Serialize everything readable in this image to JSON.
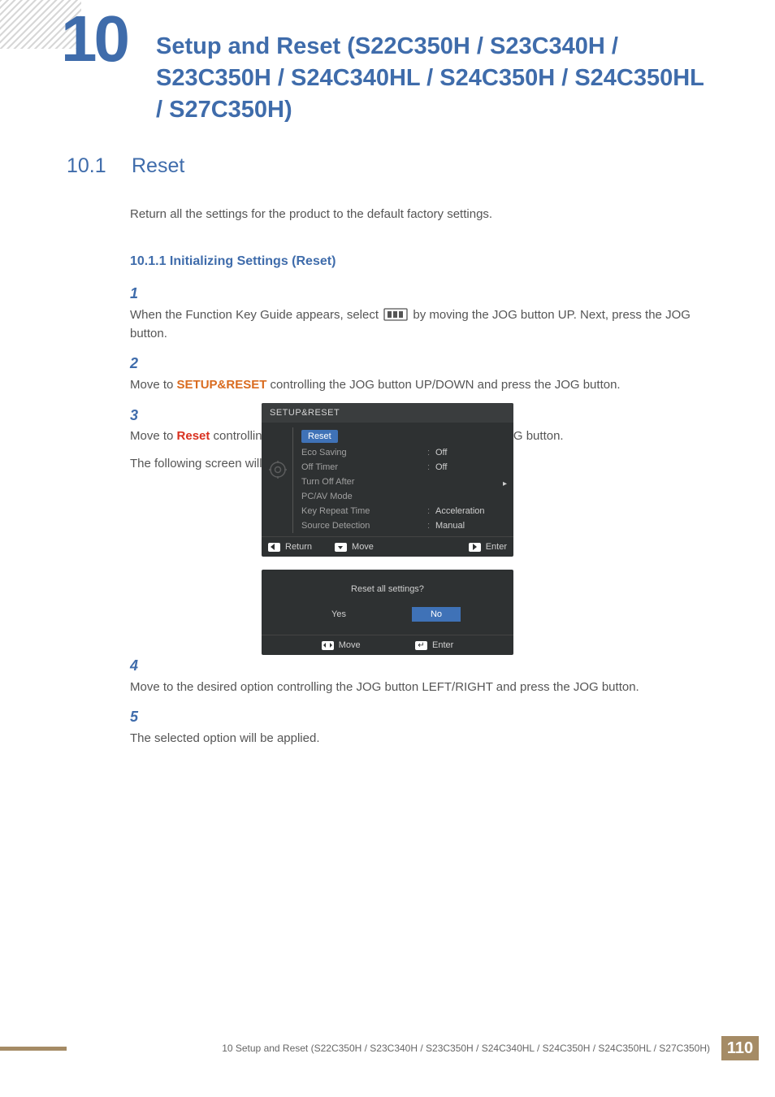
{
  "chapter": {
    "number": "10",
    "title": "Setup and Reset (S22C350H / S23C340H / S23C350H / S24C340HL / S24C350H / S24C350HL / S27C350H)"
  },
  "section": {
    "number": "10.1",
    "title": "Reset",
    "intro": "Return all the settings for the product to the default factory settings."
  },
  "subsection": "10.1.1   Initializing Settings (Reset)",
  "steps": {
    "s1": {
      "n": "1",
      "a": "When the Function Key Guide appears, select ",
      "b": " by moving the JOG button UP. Next, press the JOG button."
    },
    "s2": {
      "n": "2",
      "a": "Move to ",
      "hl": "SETUP&RESET",
      "b": " controlling the JOG button UP/DOWN and press the JOG button."
    },
    "s3": {
      "n": "3",
      "a": "Move to ",
      "hl": "Reset",
      "b": " controlling the JOG button UP/DOWN and press the JOG button.",
      "c": "The following screen will appear."
    },
    "s4": {
      "n": "4",
      "t": "Move to the desired option controlling the JOG button LEFT/RIGHT and press the JOG button."
    },
    "s5": {
      "n": "5",
      "t": "The selected option will be applied."
    }
  },
  "osd": {
    "title": "SETUP&RESET",
    "items": [
      {
        "label": "Reset",
        "value": "",
        "selected": true
      },
      {
        "label": "Eco Saving",
        "value": "Off"
      },
      {
        "label": "Off Timer",
        "value": "Off"
      },
      {
        "label": "Turn Off After",
        "value": ""
      },
      {
        "label": "PC/AV Mode",
        "value": ""
      },
      {
        "label": "Key Repeat Time",
        "value": "Acceleration"
      },
      {
        "label": "Source Detection",
        "value": "Manual"
      }
    ],
    "foot": {
      "return": "Return",
      "move": "Move",
      "enter": "Enter"
    }
  },
  "dialog": {
    "question": "Reset all settings?",
    "yes": "Yes",
    "no": "No",
    "foot": {
      "move": "Move",
      "enter": "Enter"
    }
  },
  "footer": {
    "text": "10 Setup and Reset (S22C350H / S23C340H / S23C350H / S24C340HL / S24C350H / S24C350HL / S27C350H)",
    "page": "110"
  }
}
